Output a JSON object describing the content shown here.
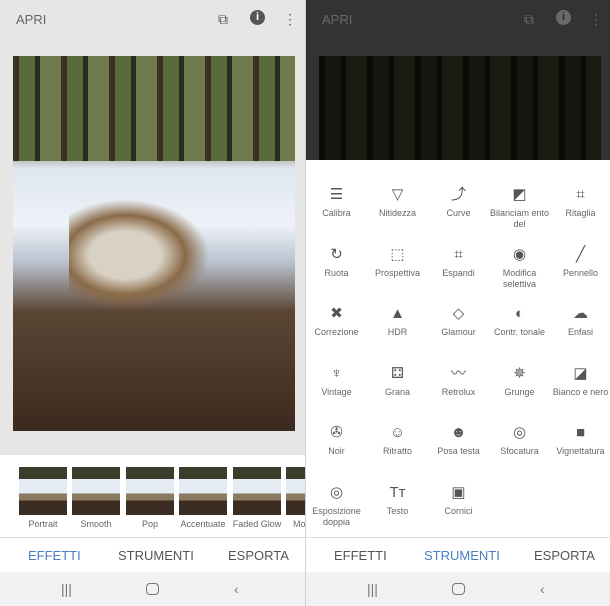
{
  "left": {
    "title": "APRI",
    "icons": [
      "layers-icon",
      "info-icon",
      "more-vert-icon"
    ],
    "filters": [
      "Portrait",
      "Smooth",
      "Pop",
      "Accentuate",
      "Faded Glow",
      "Mo"
    ],
    "tabs": [
      "EFFETTI",
      "STRUMENTI",
      "ESPORTA"
    ],
    "active_tab": "EFFETTI"
  },
  "right": {
    "title": "APRI",
    "tools": [
      {
        "label": "Calibra",
        "icon": "tune-icon"
      },
      {
        "label": "Nitidezza",
        "icon": "triangle-icon"
      },
      {
        "label": "Curve",
        "icon": "curve-icon"
      },
      {
        "label": "Bilanciam ento del",
        "icon": "white-balance-icon"
      },
      {
        "label": "Ritaglia",
        "icon": "crop-icon"
      },
      {
        "label": "Ruota",
        "icon": "rotate-icon"
      },
      {
        "label": "Prospettiva",
        "icon": "perspective-icon"
      },
      {
        "label": "Espandi",
        "icon": "expand-icon"
      },
      {
        "label": "Modifica selettiva",
        "icon": "selective-icon"
      },
      {
        "label": "Pennello",
        "icon": "brush-icon"
      },
      {
        "label": "Correzione",
        "icon": "healing-icon"
      },
      {
        "label": "HDR",
        "icon": "mountains-icon"
      },
      {
        "label": "Glamour",
        "icon": "diamond-icon"
      },
      {
        "label": "Contr. tonale",
        "icon": "tonal-icon"
      },
      {
        "label": "Enfasi",
        "icon": "drama-icon"
      },
      {
        "label": "Vintage",
        "icon": "lamp-icon"
      },
      {
        "label": "Grana",
        "icon": "grain-icon"
      },
      {
        "label": "Retrolux",
        "icon": "mustache-icon"
      },
      {
        "label": "Grunge",
        "icon": "grunge-icon"
      },
      {
        "label": "Bianco e nero",
        "icon": "bw-icon"
      },
      {
        "label": "Noir",
        "icon": "film-reel-icon"
      },
      {
        "label": "Ritratto",
        "icon": "face-icon"
      },
      {
        "label": "Posa testa",
        "icon": "head-pose-icon"
      },
      {
        "label": "Sfocatura",
        "icon": "blur-icon"
      },
      {
        "label": "Vignettatura",
        "icon": "vignette-icon"
      },
      {
        "label": "Esposizione doppia",
        "icon": "double-exposure-icon"
      },
      {
        "label": "Testo",
        "icon": "text-icon"
      },
      {
        "label": "Cornici",
        "icon": "frame-icon"
      }
    ],
    "tabs": [
      "EFFETTI",
      "STRUMENTI",
      "ESPORTA"
    ],
    "active_tab": "STRUMENTI"
  },
  "colors": {
    "accent": "#4a7fc1"
  }
}
